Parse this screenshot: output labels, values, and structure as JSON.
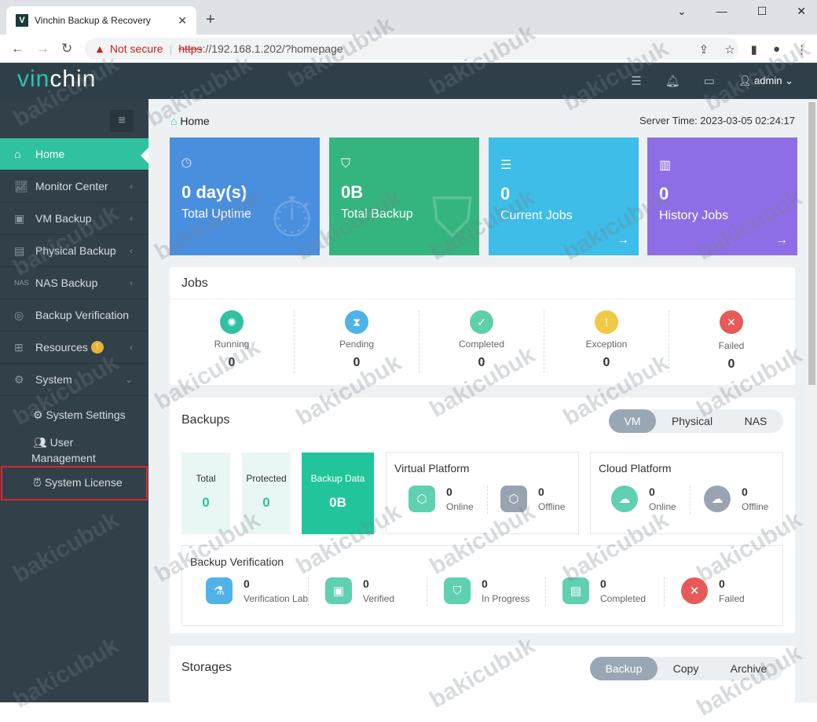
{
  "browser": {
    "tab_title": "Vinchin Backup & Recovery",
    "favicon": "V",
    "new_tab": "+",
    "not_secure": "Not secure",
    "url_scheme": "https",
    "url_rest": "://192.168.1.202/?homepage"
  },
  "app": {
    "logo_vi": "vin",
    "logo_rest": "chin",
    "user": "admin"
  },
  "sidebar": {
    "items": [
      {
        "label": "Home",
        "icon": "home-icon"
      },
      {
        "label": "Monitor Center",
        "icon": "monitor-icon"
      },
      {
        "label": "VM Backup",
        "icon": "vm-icon"
      },
      {
        "label": "Physical Backup",
        "icon": "server-icon"
      },
      {
        "label": "NAS Backup",
        "icon": "nas-icon"
      },
      {
        "label": "Backup Verification",
        "icon": "verify-icon"
      },
      {
        "label": "Resources",
        "icon": "resources-icon",
        "badge": "!"
      },
      {
        "label": "System",
        "icon": "gear-icon"
      }
    ],
    "sub": {
      "settings": "System Settings",
      "user_mgmt_1": "User",
      "user_mgmt_2": "Management",
      "license": "System License"
    }
  },
  "header": {
    "breadcrumb": "Home",
    "server_time": "Server Time: 2023-03-05 02:24:17"
  },
  "cards": [
    {
      "value": "0 day(s)",
      "label": "Total Uptime",
      "color": "#4a8fde"
    },
    {
      "value": "0B",
      "label": "Total Backup",
      "color": "#34b57f"
    },
    {
      "value": "0",
      "label": "Current Jobs",
      "color": "#3dbde8"
    },
    {
      "value": "0",
      "label": "History Jobs",
      "color": "#8e6ee6"
    }
  ],
  "jobs": {
    "title": "Jobs",
    "items": [
      {
        "label": "Running",
        "value": "0",
        "color": "#2fc1a0"
      },
      {
        "label": "Pending",
        "value": "0",
        "color": "#4fb3e8"
      },
      {
        "label": "Completed",
        "value": "0",
        "color": "#5fd0a8"
      },
      {
        "label": "Exception",
        "value": "0",
        "color": "#f0c947"
      },
      {
        "label": "Failed",
        "value": "0",
        "color": "#e85a5a"
      }
    ]
  },
  "backups": {
    "title": "Backups",
    "tabs": [
      "VM",
      "Physical",
      "NAS"
    ],
    "total_label": "Total",
    "total_value": "0",
    "protected_label": "Protected",
    "protected_value": "0",
    "data_label": "Backup Data",
    "data_value": "0B",
    "virtual": {
      "title": "Virtual Platform",
      "online": "0",
      "online_label": "Online",
      "offline": "0",
      "offline_label": "Offline"
    },
    "cloud": {
      "title": "Cloud Platform",
      "online": "0",
      "online_label": "Online",
      "offline": "0",
      "offline_label": "Offline"
    },
    "verification": {
      "title": "Backup Verification",
      "items": [
        {
          "label": "Verification Lab",
          "value": "0"
        },
        {
          "label": "Verified",
          "value": "0"
        },
        {
          "label": "In Progress",
          "value": "0"
        },
        {
          "label": "Completed",
          "value": "0"
        },
        {
          "label": "Failed",
          "value": "0"
        }
      ]
    }
  },
  "storages": {
    "title": "Storages",
    "tabs": [
      "Backup",
      "Copy",
      "Archive"
    ]
  },
  "watermark": "bakicubuk"
}
